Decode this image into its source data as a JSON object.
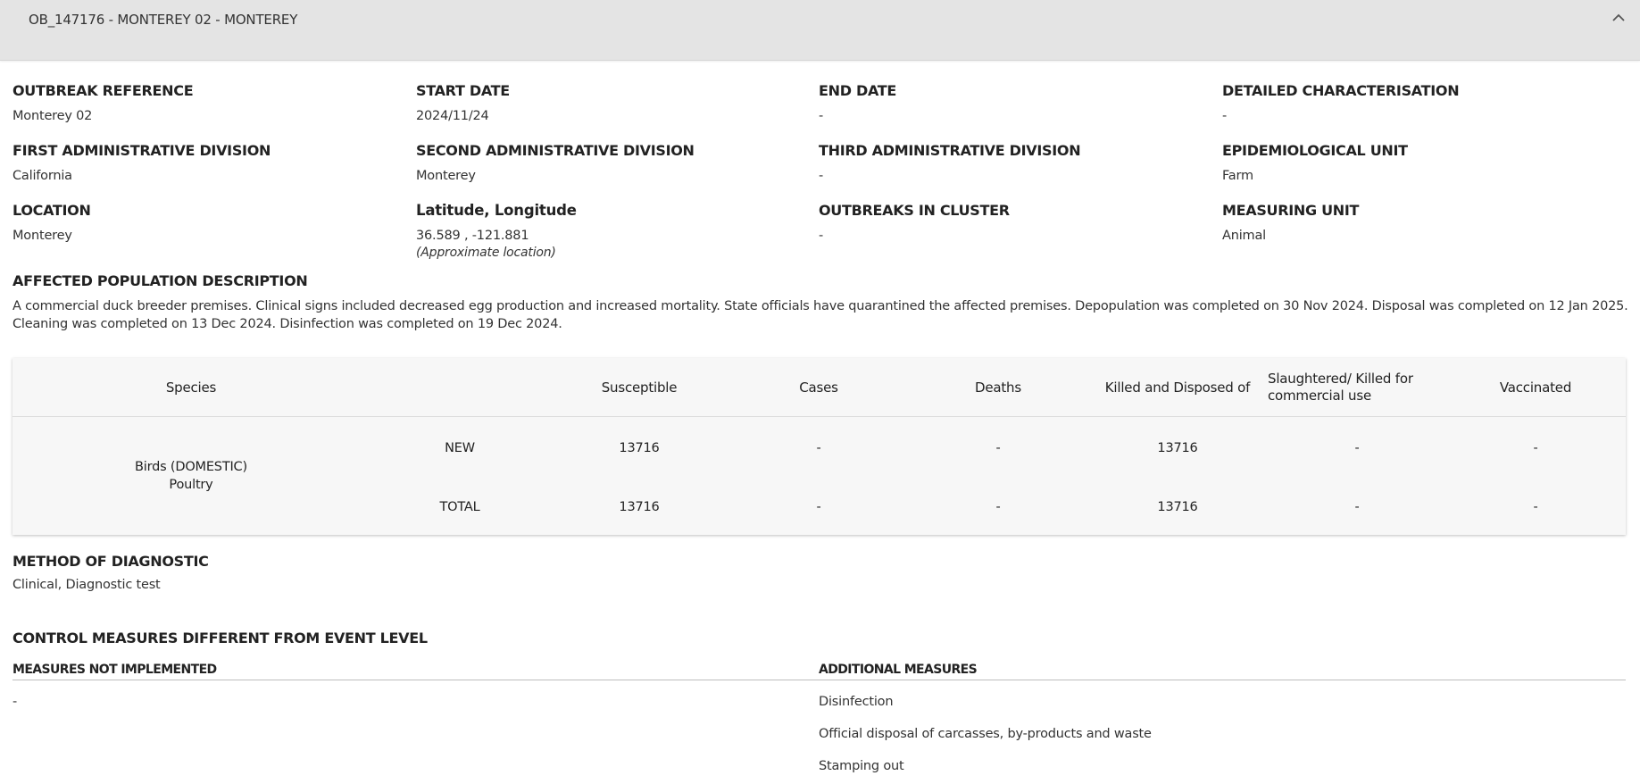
{
  "header": {
    "title": "OB_147176 - MONTEREY 02 - MONTEREY"
  },
  "fields": {
    "outbreak_reference": {
      "label": "OUTBREAK REFERENCE",
      "value": "Monterey 02"
    },
    "start_date": {
      "label": "START DATE",
      "value": "2024/11/24"
    },
    "end_date": {
      "label": "END DATE",
      "value": "-"
    },
    "detailed_characterisation": {
      "label": "DETAILED CHARACTERISATION",
      "value": "-"
    },
    "first_admin_division": {
      "label": "FIRST ADMINISTRATIVE DIVISION",
      "value": "California"
    },
    "second_admin_division": {
      "label": "SECOND ADMINISTRATIVE DIVISION",
      "value": "Monterey"
    },
    "third_admin_division": {
      "label": "THIRD ADMINISTRATIVE DIVISION",
      "value": "-"
    },
    "epidemiological_unit": {
      "label": "EPIDEMIOLOGICAL UNIT",
      "value": "Farm"
    },
    "location": {
      "label": "LOCATION",
      "value": "Monterey"
    },
    "lat_long": {
      "label": "Latitude, Longitude",
      "value": "36.589 , -121.881",
      "note": "(Approximate location)"
    },
    "outbreaks_in_cluster": {
      "label": "OUTBREAKS IN CLUSTER",
      "value": "-"
    },
    "measuring_unit": {
      "label": "MEASURING UNIT",
      "value": "Animal"
    }
  },
  "affected_population": {
    "label": "AFFECTED POPULATION DESCRIPTION",
    "text": "A commercial duck breeder premises. Clinical signs included decreased egg production and increased mortality. State officials have quarantined the affected premises. Depopulation was completed on 30 Nov 2024. Disposal was completed on 12 Jan 2025. Cleaning was completed on 13 Dec 2024. Disinfection was completed on 19 Dec 2024."
  },
  "table": {
    "headers": {
      "species": "Species",
      "susceptible": "Susceptible",
      "cases": "Cases",
      "deaths": "Deaths",
      "killed": "Killed and Disposed of",
      "slaughtered": "Slaughtered/ Killed for commercial use",
      "vaccinated": "Vaccinated"
    },
    "species_line1": "Birds (DOMESTIC)",
    "species_line2": "Poultry",
    "rows": [
      {
        "type": "NEW",
        "susceptible": "13716",
        "cases": "-",
        "deaths": "-",
        "killed": "13716",
        "slaughtered": "-",
        "vaccinated": "-"
      },
      {
        "type": "TOTAL",
        "susceptible": "13716",
        "cases": "-",
        "deaths": "-",
        "killed": "13716",
        "slaughtered": "-",
        "vaccinated": "-"
      }
    ]
  },
  "method_of_diagnostic": {
    "label": "METHOD OF DIAGNOSTIC",
    "value": "Clinical, Diagnostic test"
  },
  "control_measures": {
    "label": "CONTROL MEASURES DIFFERENT FROM EVENT LEVEL",
    "not_implemented_label": "MEASURES NOT IMPLEMENTED",
    "not_implemented": [
      "-"
    ],
    "additional_label": "ADDITIONAL MEASURES",
    "additional": [
      "Disinfection",
      "Official disposal of carcasses, by-products and waste",
      "Stamping out"
    ]
  },
  "icons": {
    "collapse": "chevron-up-icon"
  }
}
